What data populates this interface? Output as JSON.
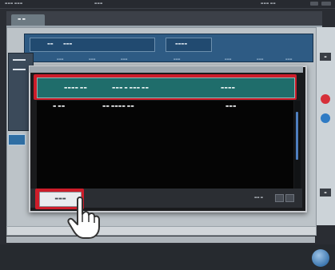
{
  "topbar": {
    "left_text": "▬▬▬ ▬▬▬",
    "mid_text": "▬▬▬",
    "right_text": "▬▬▬ ▬▬"
  },
  "tab": {
    "label": "▬ ▬"
  },
  "background_panel": {
    "field1_label": "▬▬",
    "field1_value": "▬▬▬",
    "field2_label": "▬▬▬▬",
    "sub_labels": [
      "▬▬▬",
      "▬▬▬",
      "▬▬▬",
      "▬▬▬",
      "▬▬▬",
      "▬▬▬",
      "▬▬▬"
    ]
  },
  "dialog": {
    "header_columns": [
      "▬▬▬▬ ▬▬",
      "▬▬▬ ▬ ▬▬▬ ▬▬",
      "▬▬▬▬"
    ],
    "row": [
      "▬ ▬▬",
      "▬▬ ▬▬▬▬ ▬▬",
      "▬▬▬"
    ],
    "page_info": "▬▬ ▬",
    "back_button": "▬▬▬"
  },
  "side": {
    "square_label": "▬"
  },
  "colors": {
    "highlight_red": "#cd1d2a",
    "header_teal": "#1f6d6b",
    "panel_blue": "#2e5b84",
    "scroll_blue": "#4f7fbf"
  }
}
